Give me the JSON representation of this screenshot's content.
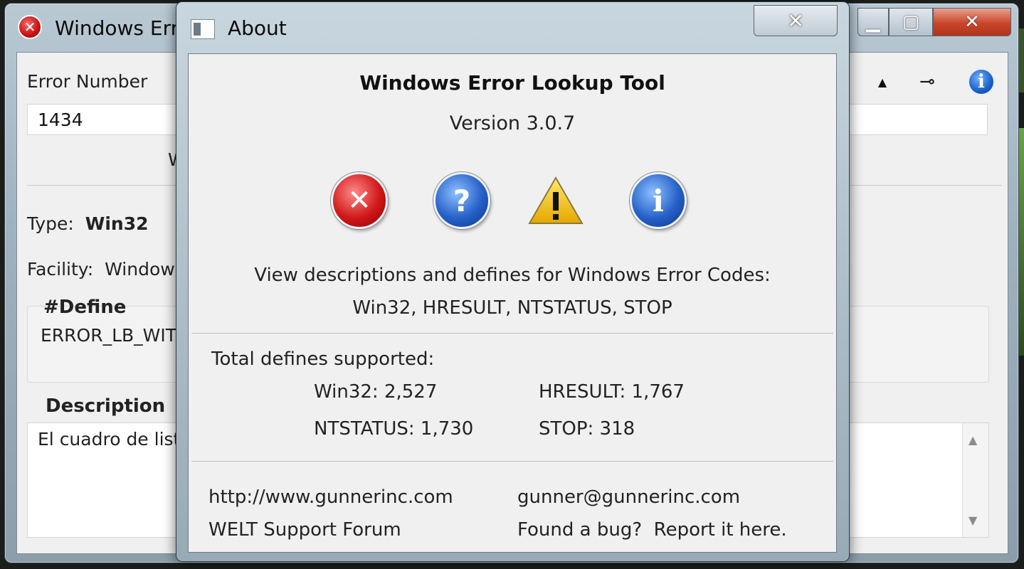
{
  "main_window": {
    "title": "Windows Error Lookup Tool",
    "error_number_label": "Error Number",
    "error_number_value": "1434",
    "type_label": "Type:",
    "type_value": "Win32",
    "facility_label": "Facility:",
    "facility_value": "Windows",
    "define_header": "#Define",
    "define_value": "ERROR_LB_WITHOUT_TABSTOPS",
    "description_header": "Description",
    "description_value": "El cuadro de lista no tiene tabulaciones.",
    "partial_button_text": "W"
  },
  "about": {
    "title": "About",
    "app_name": "Windows Error Lookup Tool",
    "version": "Version 3.0.7",
    "icons": [
      "error-icon",
      "question-icon",
      "warning-icon",
      "info-icon"
    ],
    "description_line1": "View descriptions and defines for Windows Error Codes:",
    "description_line2": "Win32, HRESULT, NTSTATUS, STOP",
    "stats_title": "Total defines supported:",
    "stats": {
      "win32": "Win32: 2,527",
      "hresult": "HRESULT: 1,767",
      "ntstatus": "NTSTATUS: 1,730",
      "stop": "STOP: 318"
    },
    "links": {
      "website": "http://www.gunnerinc.com",
      "email": "gunner@gunnerinc.com",
      "forum": "WELT Support Forum",
      "bug": "Found a bug?  Report it here."
    },
    "close_glyph": "✕"
  },
  "colors": {
    "title_gradient_top": "#c8d6df",
    "client_bg": "#f0f0f0",
    "error_red": "#d01818",
    "info_blue": "#2560c8",
    "warning_yellow": "#f2c400"
  }
}
